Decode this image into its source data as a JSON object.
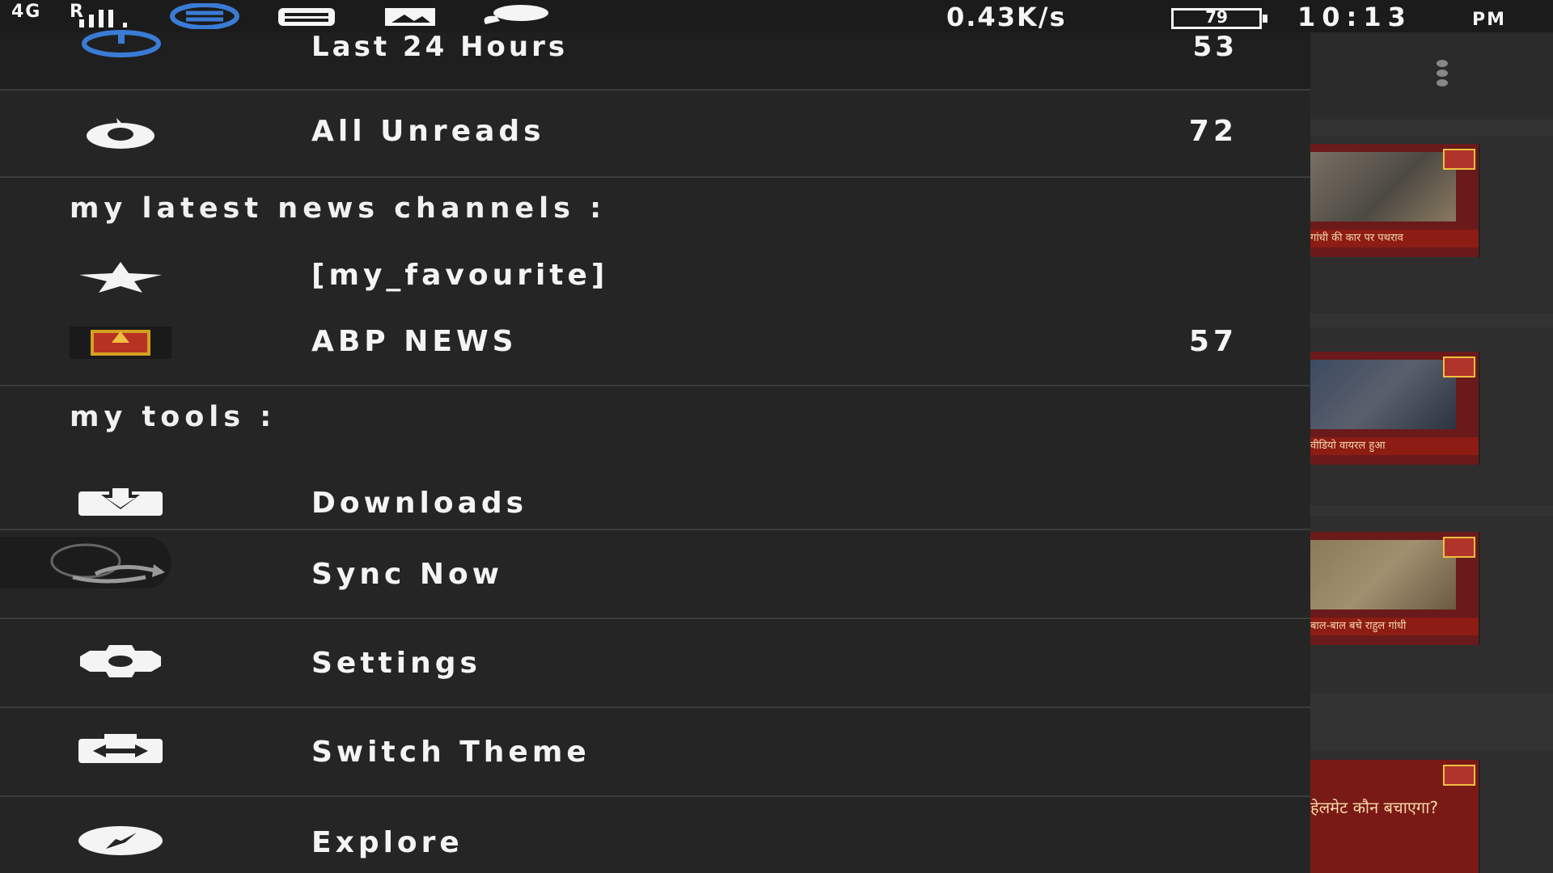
{
  "status_bar": {
    "network": "4G",
    "roaming": "R",
    "data_rate": "0.43K/s",
    "battery": "79",
    "time": "10:13",
    "ampm": "PM"
  },
  "drawer": {
    "header": {
      "label": "Last 24 Hours",
      "count": "53"
    },
    "all_unreads": {
      "label": "All Unreads",
      "count": "72"
    },
    "channels_heading": "my latest news channels :",
    "favourite": {
      "label": "[my_favourite]"
    },
    "abp": {
      "label": "ABP NEWS",
      "count": "57"
    },
    "tools_heading": "my tools :",
    "tools": {
      "downloads": "Downloads",
      "sync": "Sync Now",
      "settings": "Settings",
      "switch_theme": "Switch Theme",
      "explore": "Explore"
    }
  },
  "background": {
    "captions": [
      "गांधी की कार पर पथराव",
      "वीडियो वायरल हुआ",
      "बाल-बाल बचे राहुल गांधी",
      "हेलमेट कौन बचाएगा?"
    ]
  },
  "colors": {
    "accent_blue": "#3a7bd5",
    "drawer_bg": "#252525"
  }
}
